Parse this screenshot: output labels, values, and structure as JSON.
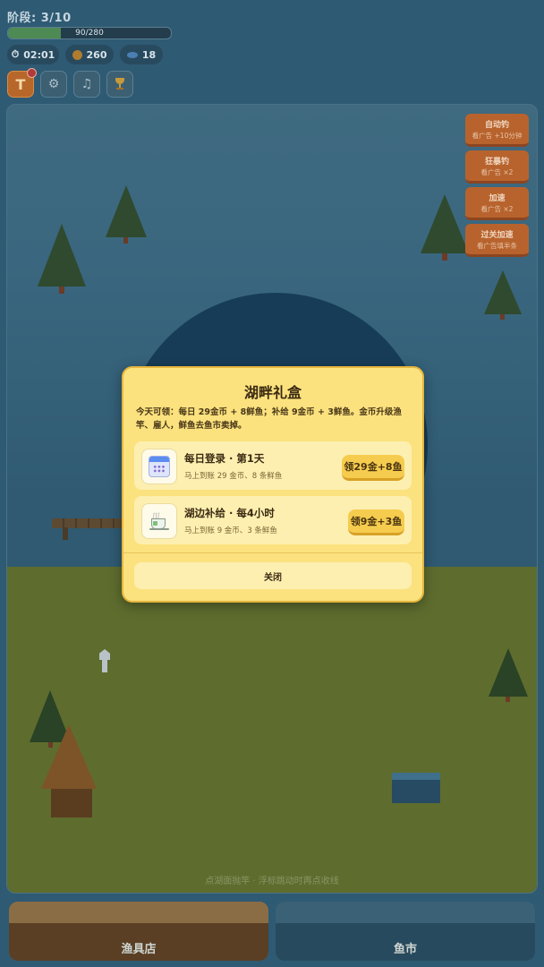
{
  "hud": {
    "stage_label": "阶段: 3/10",
    "progress_text": "90/280",
    "progress_value": 90,
    "progress_max": 280,
    "timer": "02:01",
    "coins": "260",
    "fish": "18",
    "tools": [
      {
        "icon": "tackle-t-icon",
        "label": "T",
        "has_notification": true
      },
      {
        "icon": "gear-icon",
        "label": "⚙"
      },
      {
        "icon": "music-icon",
        "label": "♫"
      },
      {
        "icon": "trophy-icon",
        "label": "🏆"
      }
    ]
  },
  "ad_buttons": [
    {
      "title": "自动钓",
      "subtitle": "看广告 +10分钟"
    },
    {
      "title": "狂暴钓",
      "subtitle": "看广告 ×2"
    },
    {
      "title": "加速",
      "subtitle": "看广告 ×2"
    },
    {
      "title": "过关加速",
      "subtitle": "看广告填半条"
    }
  ],
  "game": {
    "hint": "点湖面抛竿 · 浮标跳动时再点收线"
  },
  "modal": {
    "title": "湖畔礼盒",
    "description": "今天可领：每日 29金币 + 8鲜鱼；补给 9金币 + 3鲜鱼。金币升级渔竿、雇人，鲜鱼去鱼市卖掉。",
    "rows": [
      {
        "icon": "calendar-icon",
        "title": "每日登录 · 第1天",
        "subtitle": "马上到账 29 金币、8 条鲜鱼",
        "button": "领29金+8鱼"
      },
      {
        "icon": "tea-cup-icon",
        "title": "湖边补给 · 每4小时",
        "subtitle": "马上到账 9 金币、3 条鲜鱼",
        "button": "领9金+3鱼"
      }
    ],
    "close_label": "关闭"
  },
  "bottom": {
    "shop_label": "渔具店",
    "market_label": "鱼市"
  },
  "colors": {
    "accent_orange": "#b8632d",
    "modal_bg": "#fbe27e",
    "claim_button": "#f5cc4e"
  }
}
